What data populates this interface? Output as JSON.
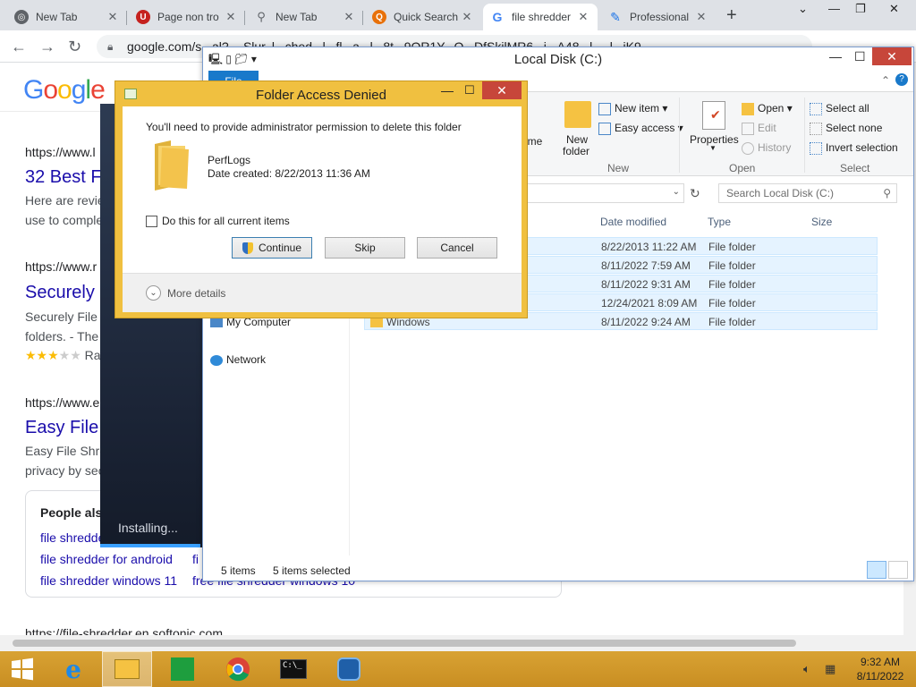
{
  "browser": {
    "tabs": [
      {
        "label": "New Tab",
        "icon": "chrome-icon",
        "color": "#5f6368"
      },
      {
        "label": "Page non tro",
        "icon": "opera-like-icon",
        "color": "#c5221f"
      },
      {
        "label": "New Tab",
        "icon": "search-icon",
        "color": "#5f6368"
      },
      {
        "label": "Quick Search",
        "icon": "quick-search-icon",
        "color": "#e8710a"
      },
      {
        "label": "file shredder",
        "icon": "google-icon",
        "color": "#4285f4"
      },
      {
        "label": "Professional",
        "icon": "professional-icon",
        "color": "#1a73e8"
      }
    ],
    "url": "google.com/s...al?-...Slur..l...ched...l...fl...a...l...8t...9OR1Y...O...DfSkilMR6...i...A48...l.....l...iK9"
  },
  "google": {
    "logo": "Google",
    "results": [
      {
        "url": "https://www.l",
        "title": "32 Best F",
        "snippet1": "Here are revie",
        "snippet2": "use to comple"
      },
      {
        "url": "https://www.r",
        "title": "Securely F",
        "snippet1": "Securely File",
        "snippet2": "folders. - The",
        "rating": "Ra"
      },
      {
        "url": "https://www.e",
        "title": "Easy File",
        "snippet1": "Easy File Shre",
        "snippet2": "privacy by sec"
      }
    ],
    "people_also": "People also",
    "links": [
      "file shredde",
      "file shredder for android",
      "fi",
      "file shredder windows 11",
      "free file shredder windows 10"
    ],
    "bottom_url": "https://file-shredder.en.softonic.com"
  },
  "installer": {
    "status": "Installing..."
  },
  "explorer": {
    "title": "Local Disk (C:)",
    "file_tab": "File",
    "ribbon": {
      "rename": "ame",
      "new_folder_1": "New",
      "new_folder_2": "folder",
      "new_item": "New item",
      "easy_access": "Easy access",
      "group_new": "New",
      "properties": "Properties",
      "open": "Open",
      "edit": "Edit",
      "history": "History",
      "group_open": "Open",
      "select_all": "Select all",
      "select_none": "Select none",
      "invert_selection": "Invert selection",
      "group_select": "Select"
    },
    "search_placeholder": "Search Local Disk (C:)",
    "columns": {
      "date": "Date modified",
      "type": "Type",
      "size": "Size"
    },
    "rows": [
      {
        "name": "",
        "date": "8/22/2013 11:22 AM",
        "type": "File folder"
      },
      {
        "name": "",
        "date": "8/11/2022 7:59 AM",
        "type": "File folder"
      },
      {
        "name": "",
        "date": "8/11/2022 9:31 AM",
        "type": "File folder"
      },
      {
        "name": "",
        "date": "12/24/2021 8:09 AM",
        "type": "File folder"
      },
      {
        "name": "Windows",
        "date": "8/11/2022 9:24 AM",
        "type": "File folder"
      }
    ],
    "nav": {
      "my_computer": "My Computer",
      "network": "Network"
    },
    "status": {
      "items": "5 items",
      "selected": "5 items selected"
    }
  },
  "dialog": {
    "title": "Folder Access Denied",
    "message": "You'll need to provide administrator permission to delete this folder",
    "folder_name": "PerfLogs",
    "folder_date": "Date created: 8/22/2013 11:36 AM",
    "checkbox_label": "Do this for all current items",
    "continue": "Continue",
    "skip": "Skip",
    "cancel": "Cancel",
    "more_details": "More details"
  },
  "taskbar": {
    "time": "9:32 AM",
    "date": "8/11/2022"
  }
}
